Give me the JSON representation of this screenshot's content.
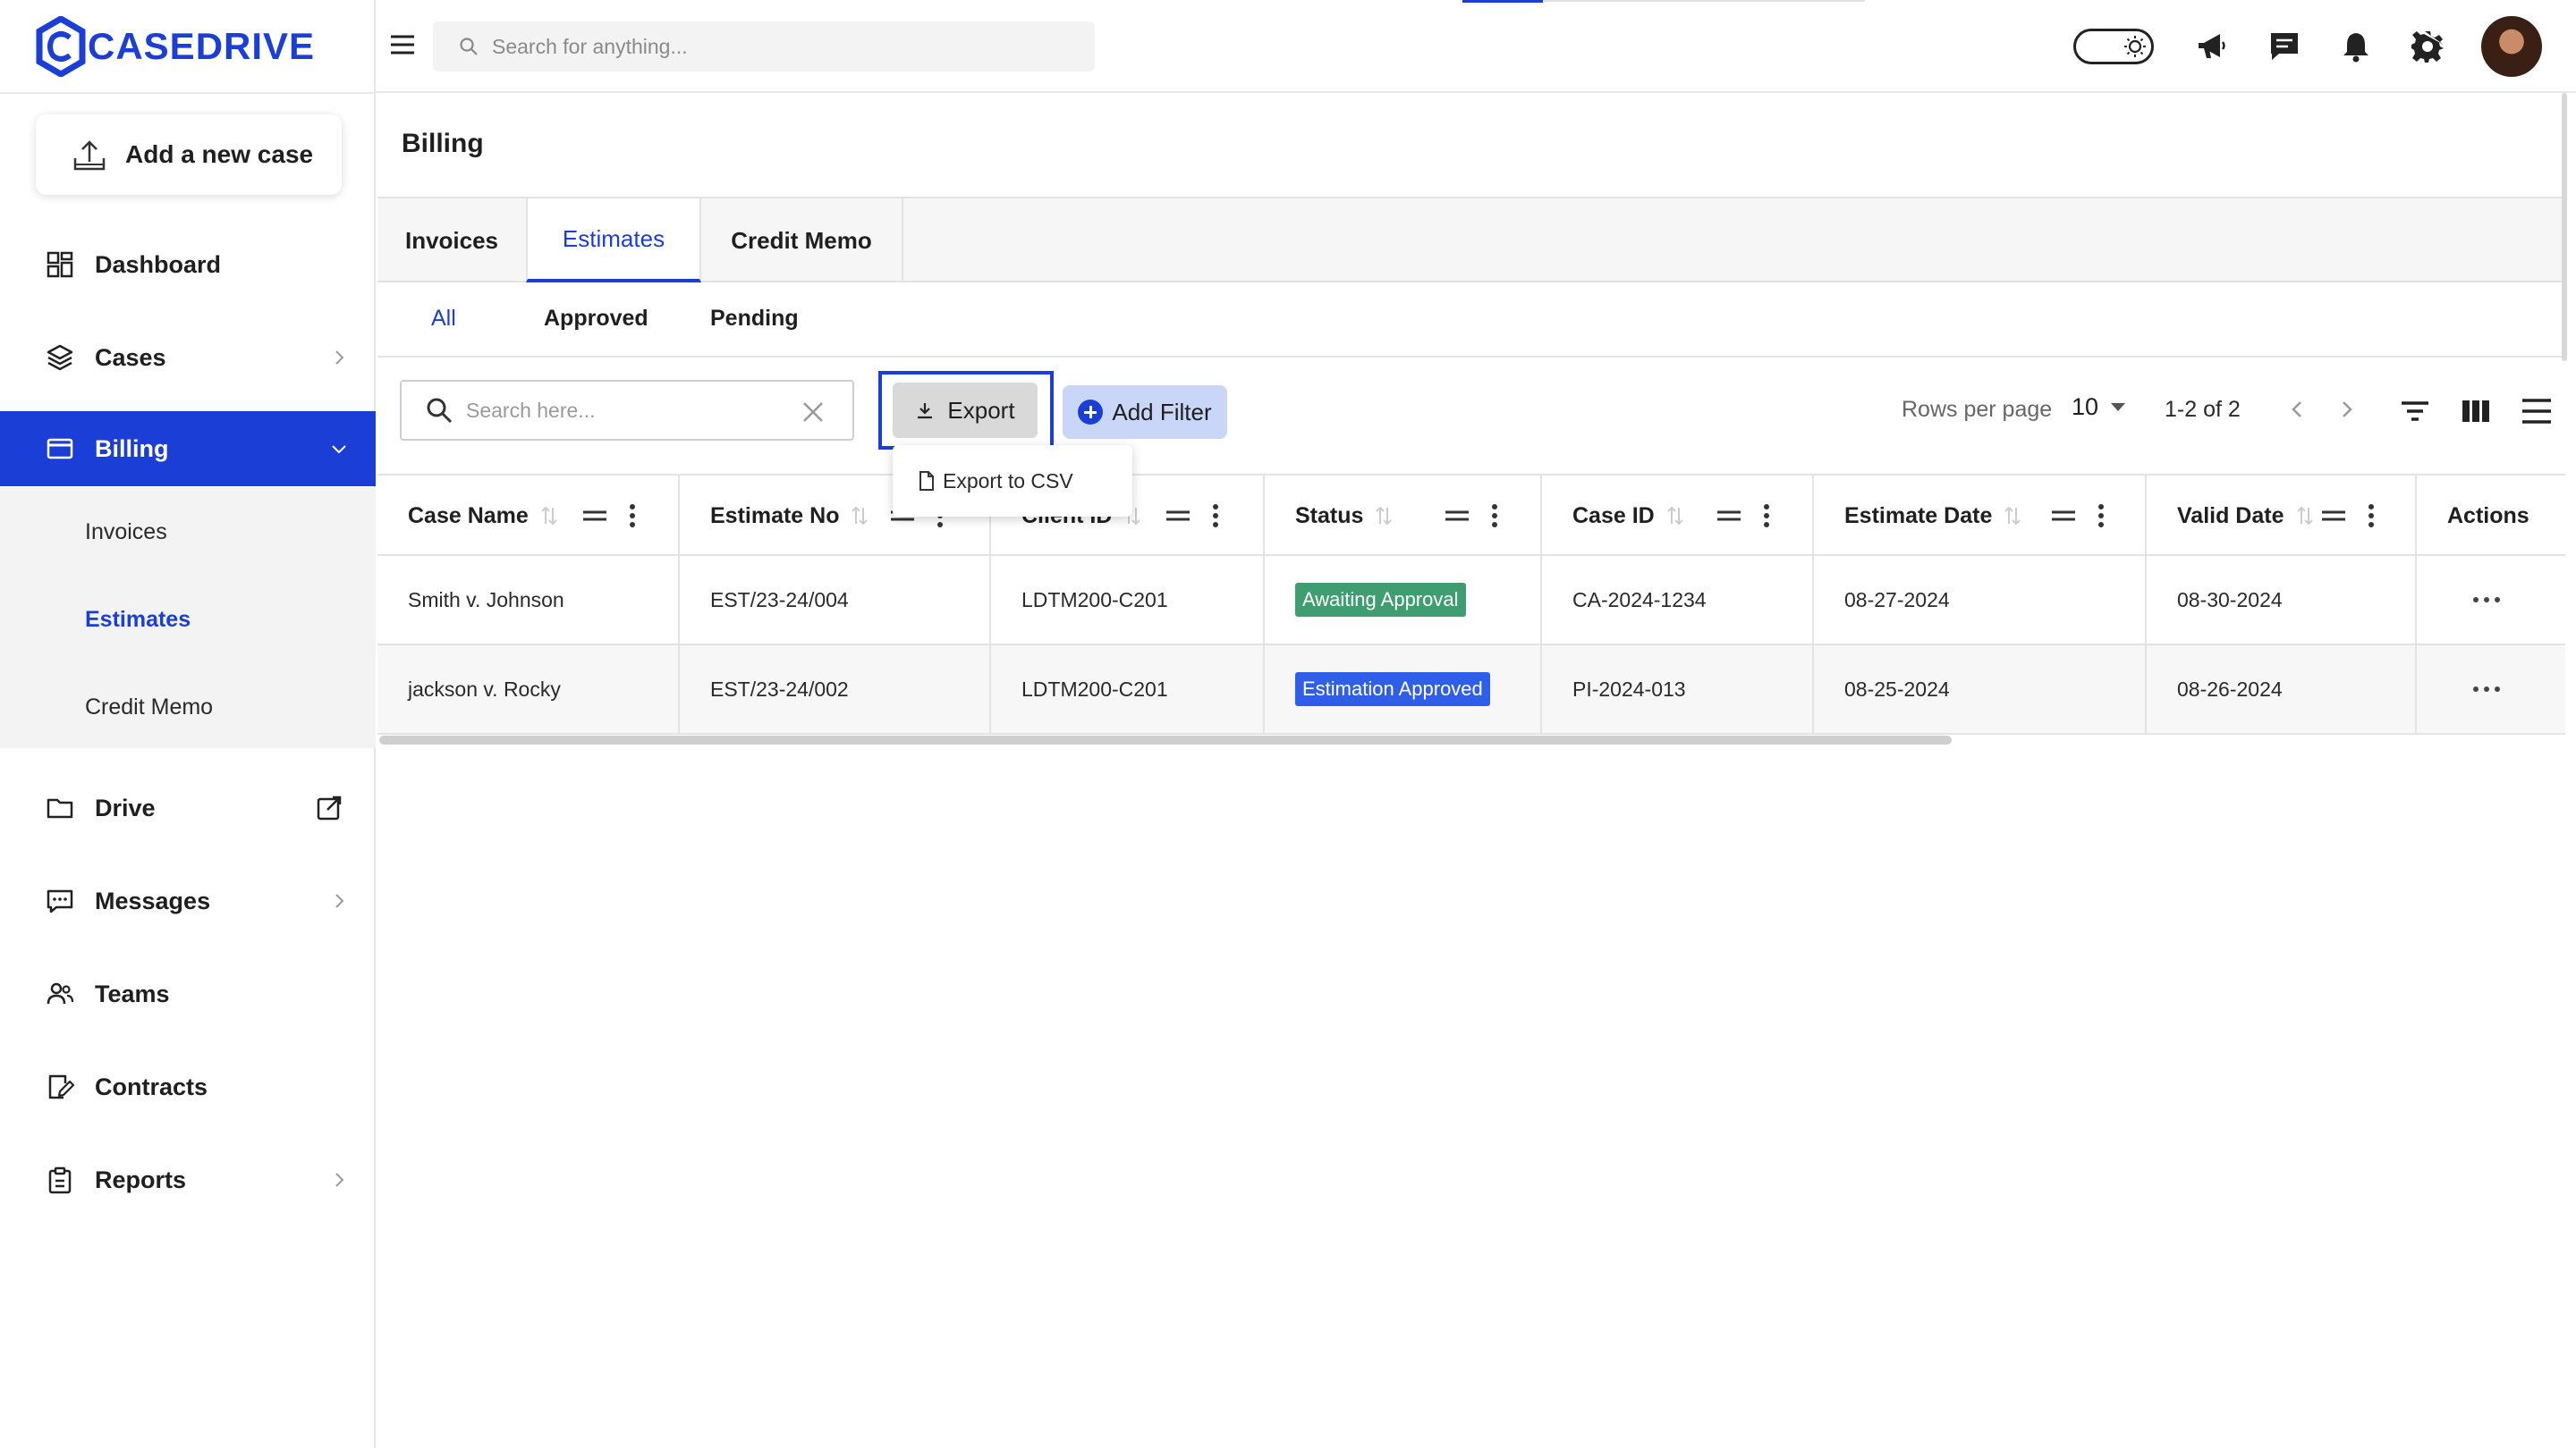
{
  "brand": {
    "name": "CASEDRIVE",
    "color": "#1b3fd6"
  },
  "sidebar": {
    "add_case_label": "Add a new case",
    "items": [
      {
        "label": "Dashboard",
        "icon": "dashboard-icon"
      },
      {
        "label": "Cases",
        "icon": "layers-icon",
        "has_chevron": true
      },
      {
        "label": "Billing",
        "icon": "credit-card-icon",
        "active": true,
        "expanded": true
      },
      {
        "label": "Drive",
        "icon": "folder-icon",
        "external": true
      },
      {
        "label": "Messages",
        "icon": "message-icon",
        "has_chevron": true
      },
      {
        "label": "Teams",
        "icon": "team-icon"
      },
      {
        "label": "Contracts",
        "icon": "contract-icon"
      },
      {
        "label": "Reports",
        "icon": "clipboard-icon",
        "has_chevron": true
      }
    ],
    "billing_sub": [
      {
        "label": "Invoices"
      },
      {
        "label": "Estimates",
        "active": true
      },
      {
        "label": "Credit Memo"
      }
    ]
  },
  "topbar": {
    "search_placeholder": "Search for anything...",
    "icons": [
      "menu-icon",
      "theme-toggle",
      "megaphone-icon",
      "chat-icon",
      "bell-icon",
      "settings-icon",
      "avatar"
    ]
  },
  "main": {
    "page_title": "Billing",
    "tabs": [
      {
        "label": "Invoices"
      },
      {
        "label": "Estimates",
        "active": true
      },
      {
        "label": "Credit Memo"
      }
    ],
    "subtabs": [
      {
        "label": "All",
        "active": true
      },
      {
        "label": "Approved"
      },
      {
        "label": "Pending"
      }
    ],
    "toolbar": {
      "search_placeholder": "Search here...",
      "export_label": "Export",
      "export_menu_item": "Export to CSV",
      "add_filter_label": "Add Filter",
      "rows_per_page_label": "Rows per page",
      "rows_per_page_value": "10",
      "pagination": "1-2 of 2"
    },
    "table": {
      "columns": [
        "Case Name",
        "Estimate No",
        "Client ID",
        "Status",
        "Case ID",
        "Estimate Date",
        "Valid Date",
        "Actions"
      ],
      "rows": [
        {
          "case_name": "Smith v. Johnson",
          "estimate_no": "EST/23-24/004",
          "client_id": "LDTM200-C201",
          "status": "Awaiting Approval",
          "status_color": "#3e9e72",
          "case_id": "CA-2024-1234",
          "estimate_date": "08-27-2024",
          "valid_date": "08-30-2024"
        },
        {
          "case_name": "jackson v. Rocky",
          "estimate_no": "EST/23-24/002",
          "client_id": "LDTM200-C201",
          "status": "Estimation Approved",
          "status_color": "#2f5ee8",
          "case_id": "PI-2024-013",
          "estimate_date": "08-25-2024",
          "valid_date": "08-26-2024"
        }
      ]
    }
  }
}
